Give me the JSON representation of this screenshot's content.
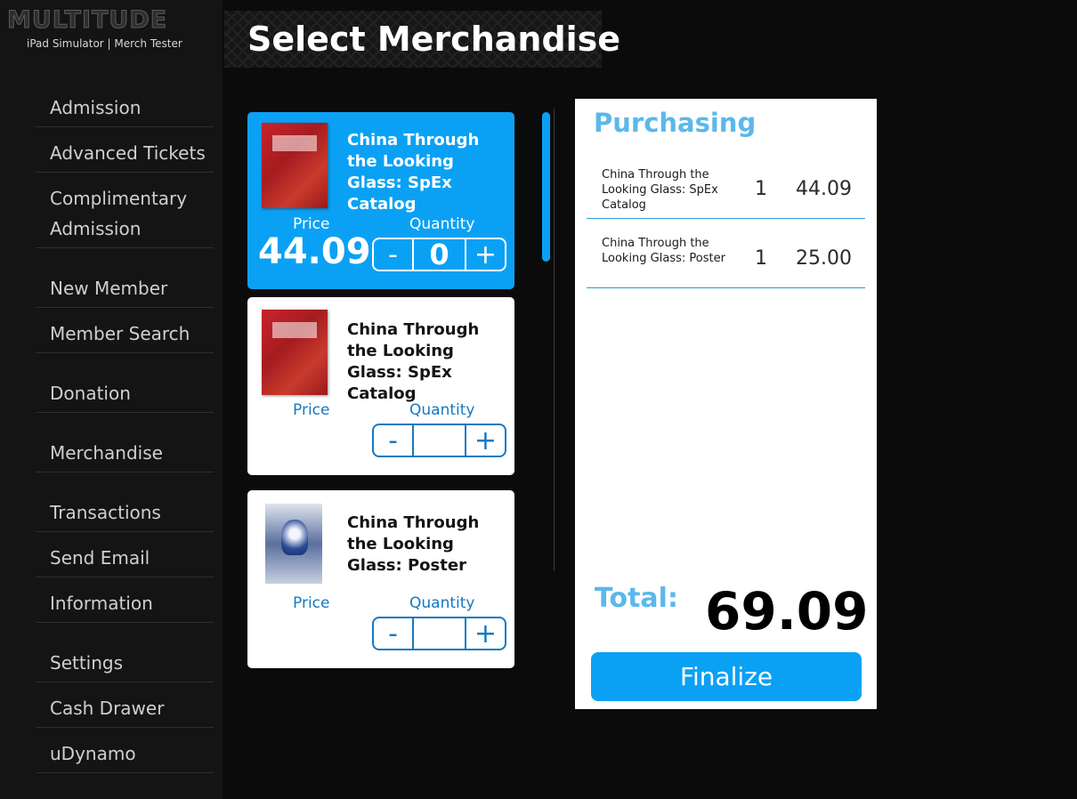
{
  "brand": {
    "logo_text": "MULTITUDE",
    "subtitle": "iPad Simulator | Merch Tester"
  },
  "sidebar": {
    "items": [
      {
        "label": "Admission"
      },
      {
        "label": "Advanced Tickets"
      },
      {
        "label": "Complimentary Admission"
      },
      {
        "label": "New Member"
      },
      {
        "label": "Member Search"
      },
      {
        "label": "Donation"
      },
      {
        "label": "Merchandise"
      },
      {
        "label": "Transactions"
      },
      {
        "label": "Send Email"
      },
      {
        "label": "Information"
      },
      {
        "label": "Settings"
      },
      {
        "label": "Cash Drawer"
      },
      {
        "label": "uDynamo"
      }
    ]
  },
  "header": {
    "title": "Select Merchandise"
  },
  "products": [
    {
      "title": "China Through the Looking Glass: SpEx Catalog",
      "price_label": "Price",
      "price": "44.09",
      "quantity_label": "Quantity",
      "quantity": "0",
      "minus": "-",
      "plus": "+",
      "thumbnail": "catalog-book-red"
    },
    {
      "title": "China Through the Looking Glass: SpEx Catalog",
      "price_label": "Price",
      "price": "",
      "quantity_label": "Quantity",
      "quantity": "",
      "minus": "-",
      "plus": "+",
      "thumbnail": "catalog-book-red"
    },
    {
      "title": "China Through the Looking Glass: Poster",
      "price_label": "Price",
      "price": "",
      "quantity_label": "Quantity",
      "quantity": "",
      "minus": "-",
      "plus": "+",
      "thumbnail": "poster-blue"
    }
  ],
  "cart": {
    "title": "Purchasing",
    "items": [
      {
        "name": "China Through the Looking Glass: SpEx Catalog",
        "qty": "1",
        "price": "44.09"
      },
      {
        "name": "China Through the Looking Glass: Poster",
        "qty": "1",
        "price": "25.00"
      }
    ],
    "total_label": "Total:",
    "total": "69.09",
    "finalize_label": "Finalize"
  },
  "colors": {
    "accent": "#0aa1f5",
    "label_blue": "#1479c2",
    "heading_blue": "#5bb8ea",
    "background": "#0b0b0b",
    "sidebar": "#141414"
  }
}
